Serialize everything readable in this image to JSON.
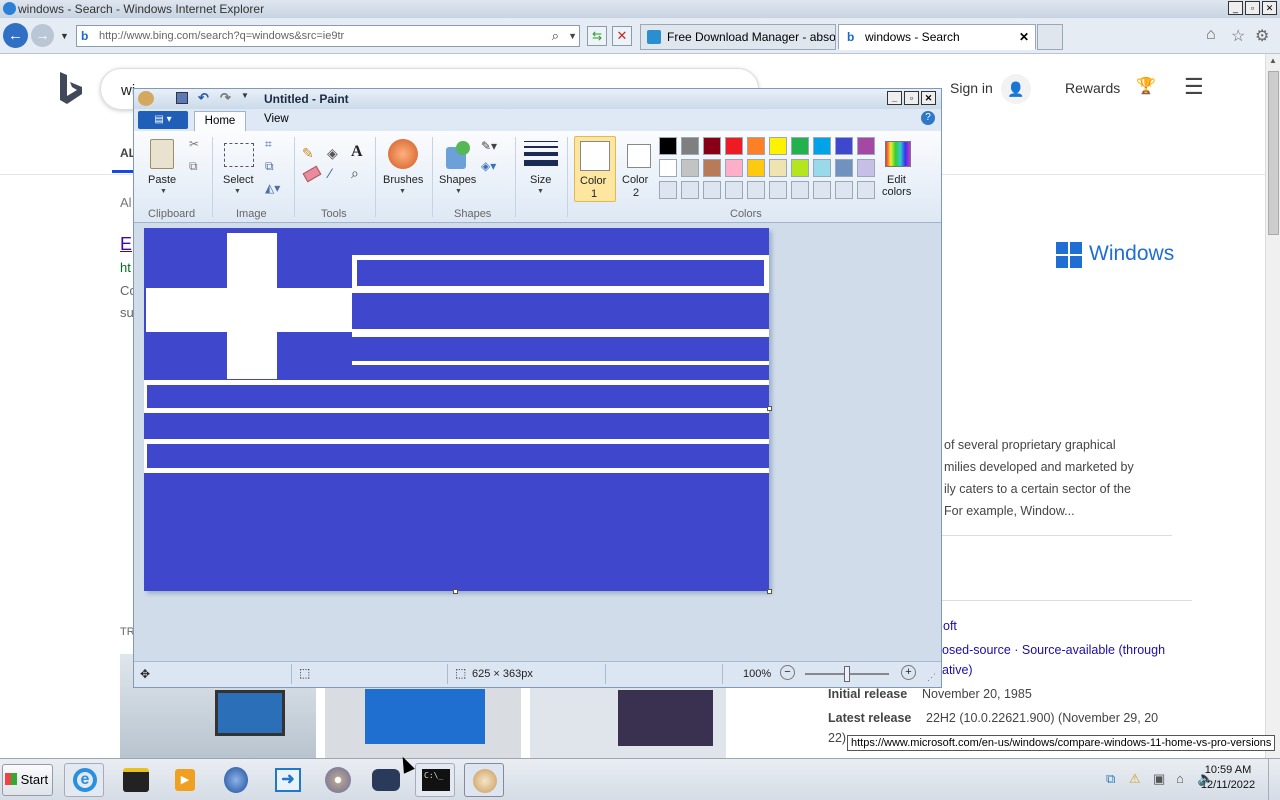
{
  "ie": {
    "title": "windows - Search - Windows Internet Explorer",
    "url": "http://www.bing.com/search?q=windows&src=ie9tr",
    "tabs": [
      {
        "label": "Free Download Manager - absolu..."
      },
      {
        "label": "windows - Search"
      }
    ]
  },
  "bing": {
    "search_value": "wi",
    "signin": "Sign in",
    "rewards": "Rewards",
    "nav_all": "AL",
    "about_prefix": "Al",
    "result_title_frag": "E",
    "result_url_frag": "ht",
    "result_snip1": "Co",
    "result_snip2": "su",
    "trending": "TR",
    "windows_logo_text": "Windows",
    "desc_lines": [
      "of several proprietary graphical",
      "milies developed and marketed by",
      "ily caters to a certain sector of the",
      "For example, Window..."
    ],
    "info_oft": "oft",
    "license_line": "osed-source · Source-available (through",
    "license_line2": "ative)",
    "source_available": "Source-available",
    "initial_release_label": "Initial release",
    "initial_release_value": "November 20, 1985",
    "latest_release_label": "Latest release",
    "latest_release_value": "22H2 (10.0.22621.900) (November 29, 20",
    "latest_release_tail": "22)"
  },
  "paint": {
    "title": "Untitled - Paint",
    "tabs": {
      "home": "Home",
      "view": "View"
    },
    "groups": {
      "clipboard": "Clipboard",
      "image": "Image",
      "tools": "Tools",
      "shapes": "Shapes",
      "colors": "Colors"
    },
    "buttons": {
      "paste": "Paste",
      "select": "Select",
      "brushes": "Brushes",
      "shapes": "Shapes",
      "size": "Size",
      "color1": "Color",
      "color1_num": "1",
      "color2": "Color",
      "color2_num": "2",
      "edit_colors": "Edit",
      "edit_colors2": "colors"
    },
    "palette_row1": [
      "#000000",
      "#7f7f7f",
      "#880015",
      "#ed1c24",
      "#ff7f27",
      "#fff200",
      "#22b14c",
      "#00a2e8",
      "#3f48cc",
      "#a349a4"
    ],
    "palette_row2": [
      "#ffffff",
      "#c3c3c3",
      "#b97a57",
      "#ffaec9",
      "#ffc90e",
      "#efe4b0",
      "#b5e61d",
      "#99d9ea",
      "#7092be",
      "#c8bfe7"
    ],
    "flag_color": "#3f48cc",
    "status_size": "625 × 363px",
    "zoom": "100%"
  },
  "tooltip": "https://www.microsoft.com/en-us/windows/compare-windows-11-home-vs-pro-versions",
  "taskbar": {
    "start": "Start",
    "time": "10:59 AM",
    "date": "12/11/2022"
  }
}
